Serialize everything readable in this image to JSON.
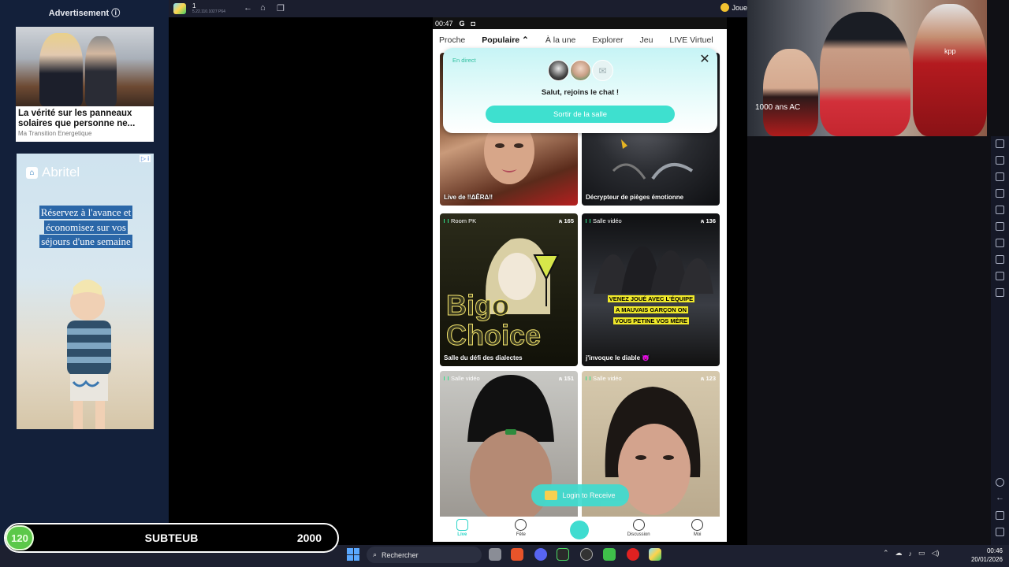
{
  "ad_panel": {
    "title": "Advertisement ⓘ",
    "ad1": {
      "headline": "La vérité sur les panneaux solaires que personne ne...",
      "source": "Ma Transition Energetique"
    },
    "ad2": {
      "brand": "Abritel",
      "text_lines": [
        "Réservez à l'avance et",
        "économisez sur vos",
        "séjours d'une semaine"
      ],
      "choice_badge": "▷ i"
    }
  },
  "emulator": {
    "instance_name": "1",
    "version": "5.22.110.1027 P64",
    "right_label": "Joue"
  },
  "phone": {
    "status": {
      "time": "00:47",
      "icons": [
        "G",
        "◘"
      ]
    },
    "tabs": [
      {
        "label": "Proche",
        "active": false
      },
      {
        "label": "Populaire ⌃",
        "active": true
      },
      {
        "label": "À la une",
        "active": false
      },
      {
        "label": "Explorer",
        "active": false
      },
      {
        "label": "Jeu",
        "active": false
      },
      {
        "label": "LIVE Virtuel",
        "active": false
      }
    ],
    "popup": {
      "live_label": "En direct",
      "message": "Salut, rejoins le chat !",
      "button": "Sortir de la salle",
      "close": "✕"
    },
    "cards": [
      {
        "type": "",
        "count": "",
        "title": "Live de ‼ΔÊRΔ‼"
      },
      {
        "type": "",
        "count": "",
        "title": "Décrypteur de pièges émotionne"
      },
      {
        "type": "Room PK",
        "count": "ጰ 165",
        "title": "Salle du défi des dialectes",
        "overlay": "Bigo Choice"
      },
      {
        "type": "Salle vidéo",
        "count": "ጰ 136",
        "title": "j'invoque le diable 😈",
        "overlay_lines": [
          "VENEZ JOUÉ AVEC L'ÉQUIPE",
          "A MAUVAIS GARÇON ON",
          "VOUS PETINE VOS MÈRE"
        ]
      },
      {
        "type": "Salle vidéo",
        "count": "ጰ 151",
        "title": ""
      },
      {
        "type": "Salle vidéo",
        "count": "ጰ 123",
        "title": ""
      }
    ],
    "login_receive": "Login to Receive",
    "bottom_nav": [
      {
        "label": "Live",
        "active": true
      },
      {
        "label": "Fête",
        "active": false
      },
      {
        "label": "",
        "active": false
      },
      {
        "label": "Discussion",
        "active": false
      },
      {
        "label": "Moi",
        "active": false
      }
    ]
  },
  "webcam": {
    "shirt_text": "1000 ans AC",
    "kpp_text": "kpp"
  },
  "overlay": {
    "score_badge": "120",
    "name": "SUBTEUB",
    "value": "2000"
  },
  "taskbar": {
    "search_placeholder": "Rechercher",
    "clock_time": "00:46",
    "clock_date": "20/01/2026"
  },
  "colors": {
    "accent": "#3fdcd0",
    "ad_bg": "#13203a",
    "score_green": "#5cc84a"
  }
}
